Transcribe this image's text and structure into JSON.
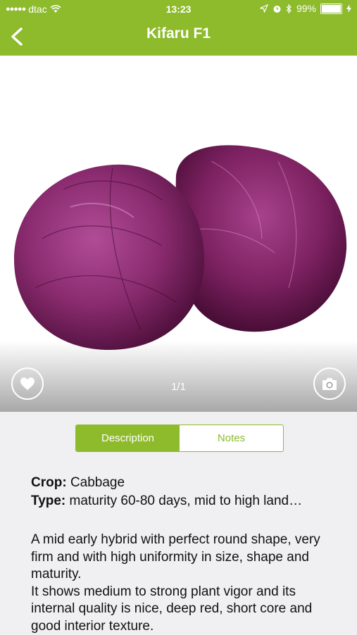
{
  "status_bar": {
    "carrier": "dtac",
    "time": "13:23",
    "battery": "99%",
    "battery_level": 0.99
  },
  "header": {
    "title": "Kifaru F1",
    "back_icon": "chevron-left-icon",
    "color": "#8dbb2c"
  },
  "gallery": {
    "counter": "1/1",
    "favorite_icon": "heart-icon",
    "camera_icon": "camera-icon"
  },
  "tabs": [
    {
      "label": "Description",
      "active": true
    },
    {
      "label": "Notes",
      "active": false
    }
  ],
  "info": {
    "crop_label": "Crop:",
    "crop_value": "Cabbage",
    "type_label": "Type:",
    "type_value": "maturity 60-80 days, mid to high land…"
  },
  "description": {
    "para1": "A mid early hybrid with perfect round shape, very firm and with high uniformity in size, shape and maturity.",
    "para2": "It shows medium to strong plant vigor and its internal quality is nice, deep red, short core and good interior texture."
  }
}
